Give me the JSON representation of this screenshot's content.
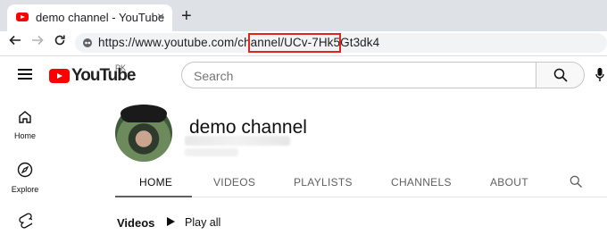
{
  "browser": {
    "tab_title": "demo channel - YouTube",
    "tab_close": "×",
    "new_tab": "+",
    "url_prefix": "https://www.youtube.com/channel/",
    "url_id": "UCv-7Hk5Gt3dk4",
    "highlight_color": "#e0251b"
  },
  "youtube": {
    "logo_text": "YouTube",
    "region": "PK",
    "search_placeholder": "Search",
    "left_nav": [
      {
        "label": "Home",
        "icon": "home-icon"
      },
      {
        "label": "Explore",
        "icon": "compass-icon"
      },
      {
        "label": "",
        "icon": "shorts-icon"
      }
    ]
  },
  "channel": {
    "name": "demo channel",
    "tabs": [
      "HOME",
      "VIDEOS",
      "PLAYLISTS",
      "CHANNELS",
      "ABOUT"
    ],
    "active_tab": "HOME",
    "section_title": "Videos",
    "play_all": "Play all"
  }
}
